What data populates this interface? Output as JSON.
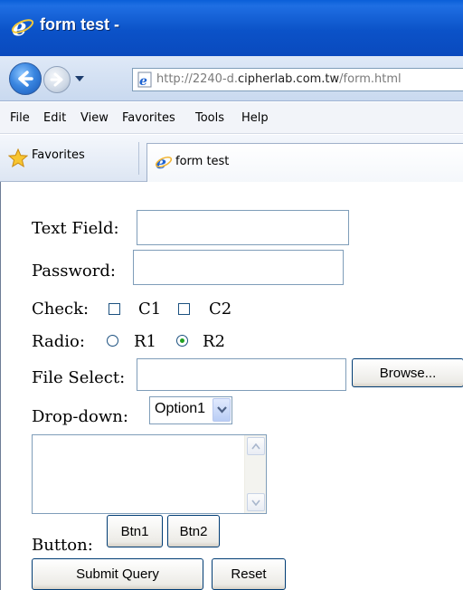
{
  "window": {
    "title": "form test -"
  },
  "navbar": {
    "address_prefix": "http://2240-d.",
    "address_domain": "cipherlab.com.tw",
    "address_path": "/form.html"
  },
  "menu": {
    "items": [
      "File",
      "Edit",
      "View",
      "Favorites",
      "Tools",
      "Help"
    ]
  },
  "favorites_bar": {
    "favorites_label": "Favorites",
    "tab_label": "form test"
  },
  "form": {
    "text_field_label": "Text Field:",
    "text_field_value": "",
    "password_label": "Password:",
    "password_value": "",
    "check_label": "Check:",
    "checkboxes": [
      {
        "label": "C1",
        "checked": false
      },
      {
        "label": "C2",
        "checked": false
      }
    ],
    "radio_label": "Radio:",
    "radios": [
      {
        "label": "R1",
        "selected": false
      },
      {
        "label": "R2",
        "selected": true
      }
    ],
    "file_select_label": "File Select:",
    "file_value": "",
    "browse_label": "Browse...",
    "dropdown_label": "Drop-down:",
    "dropdown_selected": "Option1",
    "textarea_value": "",
    "button_label": "Button:",
    "btn1_label": "Btn1",
    "btn2_label": "Btn2",
    "submit_label": "Submit Query",
    "reset_label": "Reset"
  },
  "colors": {
    "titlebar": "#0b52c8",
    "radio_dot": "#21a121",
    "field_border": "#7f9db9"
  }
}
